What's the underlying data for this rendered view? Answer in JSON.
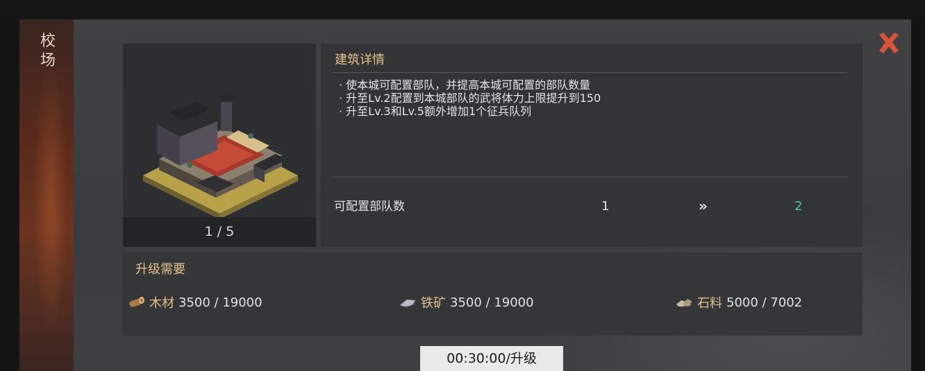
{
  "sidebar": {
    "title_chars": [
      "校",
      "场"
    ]
  },
  "building": {
    "page_indicator": "1 / 5"
  },
  "details": {
    "title": "建筑详情",
    "lines": [
      "· 使本城可配置部队，并提高本城可配置的部队数量",
      "· 升至Lv.2配置到本城部队的武将体力上限提升到150",
      "· 升至Lv.3和Lv.5额外增加1个征兵队列"
    ],
    "stat": {
      "label": "可配置部队数",
      "current": "1",
      "arrow": "»",
      "next": "2"
    }
  },
  "requirements": {
    "title": "升级需要",
    "resources": [
      {
        "icon": "wood-log-icon",
        "name": "木材",
        "amount": "3500 / 19000"
      },
      {
        "icon": "iron-ore-icon",
        "name": "铁矿",
        "amount": "3500 / 19000"
      },
      {
        "icon": "stone-icon",
        "name": "石料",
        "amount": "5000 / 7002"
      }
    ]
  },
  "upgrade": {
    "time_label": "00:30:00/升级"
  },
  "colors": {
    "accent_gold": "#e2c18a",
    "increase_green": "#4fc9a1",
    "close_red": "#d9533a"
  }
}
